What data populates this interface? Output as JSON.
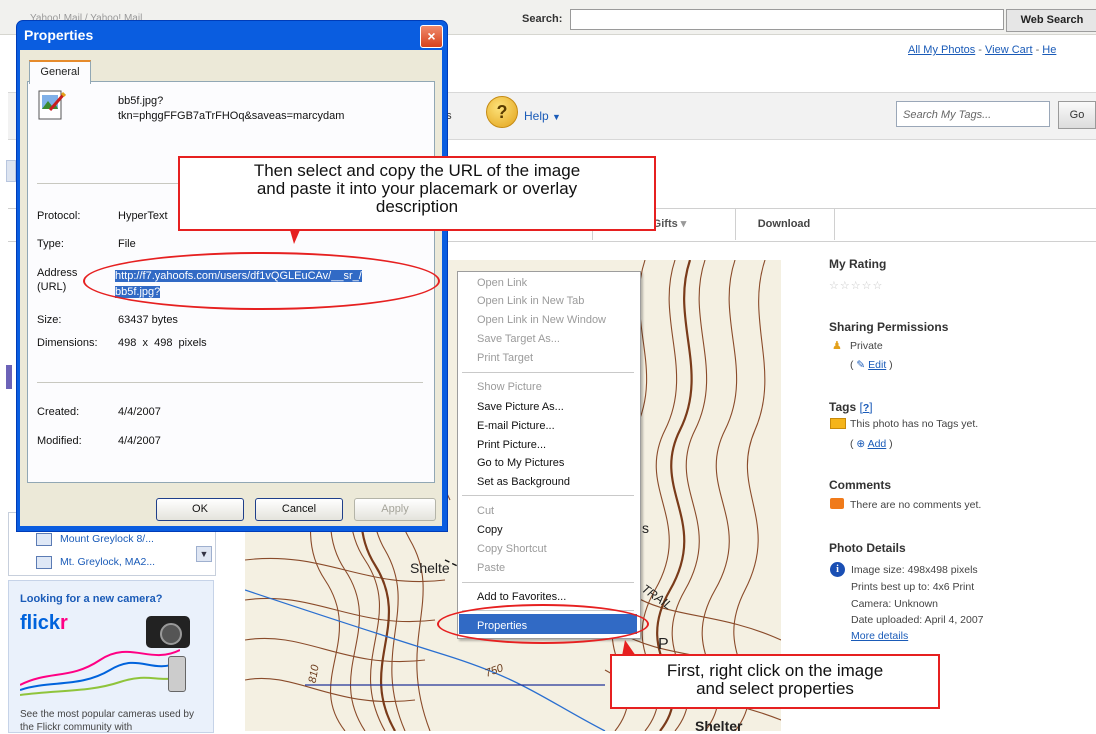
{
  "browser": {
    "search_label": "Search:",
    "search_value": "",
    "web_search_button": "Web Search",
    "left_tab_partial": "Yahoo! Mail / Yahoo! Mail"
  },
  "top_links": {
    "all_my_photos": "All My Photos",
    "sep": " - ",
    "view_cart": "View Cart",
    "help_partial": "He"
  },
  "toolbar": {
    "tags_partial": "gs",
    "help_label": "Help",
    "search_tags_placeholder": "Search My Tags...",
    "go": "Go"
  },
  "photo_tabs": {
    "gifts": "& Gifts",
    "download": "Download"
  },
  "right_panel": {
    "my_rating": "My Rating",
    "sharing_permissions": "Sharing Permissions",
    "private": "Private",
    "edit": "Edit",
    "tags": "Tags",
    "tags_help": "?",
    "no_tags": "This photo has no Tags yet.",
    "add": "Add",
    "comments": "Comments",
    "no_comments": "There are no comments yet.",
    "photo_details": "Photo Details",
    "image_size": "Image size: 498x498 pixels",
    "prints": "Prints best up to: 4x6 Print",
    "camera": "Camera: Unknown",
    "date_uploaded": "Date uploaded: April 4, 2007",
    "more_details": "More details"
  },
  "left_sidebar": {
    "item1": "Mount Greylock 8/...",
    "item2": "Mt. Greylock, MA2...",
    "camera_heading": "Looking for a new camera?",
    "flickr_logo_a": "flick",
    "flickr_logo_b": "r",
    "camera_text": "See the most popular cameras used by the Flickr community with"
  },
  "map_labels": {
    "shelter_left": "Shelte",
    "shelter_bottom": "Shelter",
    "trail": "TRAIL",
    "contour_750a": "750",
    "contour_750b": "750",
    "contour_750c": "750",
    "contour_810": "810",
    "s_label": "s",
    "p_label": "P"
  },
  "dialog": {
    "title": "Properties",
    "close": "×",
    "tab_general": "General",
    "file_name_line1": "bb5f.jpg?",
    "file_name_line2": "tkn=phggFFGB7aTrFHOq&saveas=marcydam",
    "protocol_label": "Protocol:",
    "protocol_value": "HyperText",
    "type_label": "Type:",
    "type_value": "File",
    "address_label_1": "Address",
    "address_label_2": "(URL)",
    "url_line1": "http://f7.yahoofs.com/users/df1vQGLEuCAv/__sr_/",
    "url_line2": "bb5f.jpg?",
    "size_label": "Size:",
    "size_value": "63437 bytes",
    "dimensions_label": "Dimensions:",
    "dimensions_value": "498  x  498  pixels",
    "created_label": "Created:",
    "created_value": "4/4/2007",
    "modified_label": "Modified:",
    "modified_value": "4/4/2007",
    "ok": "OK",
    "cancel": "Cancel",
    "apply": "Apply"
  },
  "context_menu": {
    "items": [
      {
        "label": "Open Link",
        "enabled": false
      },
      {
        "label": "Open Link in New Tab",
        "enabled": false
      },
      {
        "label": "Open Link in New Window",
        "enabled": false
      },
      {
        "label": "Save Target As...",
        "enabled": false
      },
      {
        "label": "Print Target",
        "enabled": false
      },
      {
        "label": "Show Picture",
        "enabled": false
      },
      {
        "label": "Save Picture As...",
        "enabled": true
      },
      {
        "label": "E-mail Picture...",
        "enabled": true
      },
      {
        "label": "Print Picture...",
        "enabled": true
      },
      {
        "label": "Go to My Pictures",
        "enabled": true
      },
      {
        "label": "Set as Background",
        "enabled": true
      },
      {
        "label": "Cut",
        "enabled": false
      },
      {
        "label": "Copy",
        "enabled": true
      },
      {
        "label": "Copy Shortcut",
        "enabled": false
      },
      {
        "label": "Paste",
        "enabled": false
      },
      {
        "label": "Add to Favorites...",
        "enabled": true
      },
      {
        "label": "Properties",
        "enabled": true,
        "selected": true
      }
    ]
  },
  "callouts": {
    "top_line1": "Then select and copy the URL of the image",
    "top_line2": "and paste it into your placemark or overlay",
    "top_line3": "description",
    "bottom_line1": "First, right click on the image",
    "bottom_line2": "and select properties"
  },
  "colors": {
    "callout_red": "#e62020",
    "xp_blue": "#0a5de0",
    "selection_blue": "#316ac5",
    "link_blue": "#1a5bb8"
  }
}
